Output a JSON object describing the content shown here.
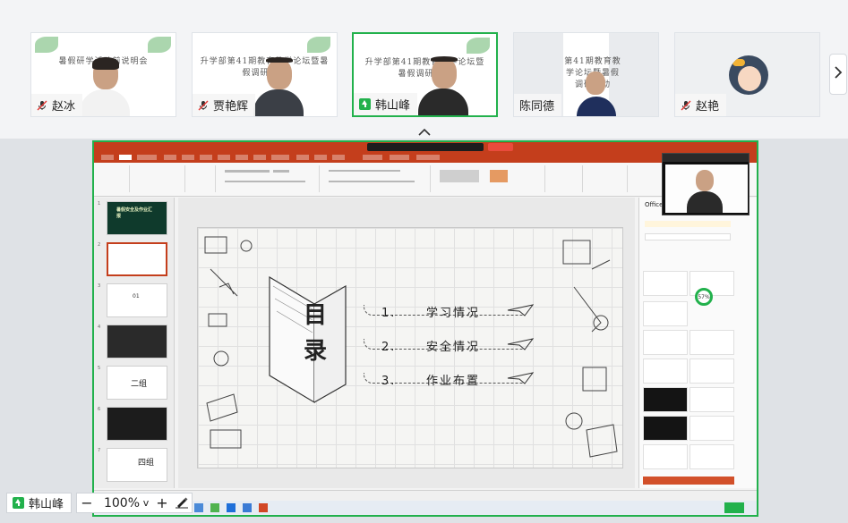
{
  "participants": [
    {
      "name": "赵冰",
      "slide_text": "暑假研学活动前说明会",
      "state": "mic-muted"
    },
    {
      "name": "贾艳辉",
      "slide_text": "升学部第41期教育教学论坛暨暑假调研活动",
      "state": "mic-muted"
    },
    {
      "name": "韩山峰",
      "slide_text": "升学部第41期教育教学论坛暨暑假调研活动",
      "state": "sharing"
    },
    {
      "name": "陈同德",
      "slide_text": "第41期教育教学论坛暨暑假调研活动",
      "state": "none"
    },
    {
      "name": "赵艳",
      "slide_text": "",
      "state": "mic-muted"
    }
  ],
  "presenter": {
    "name": "韩山峰"
  },
  "zoom": {
    "value": "100%",
    "minus": "−",
    "plus": "+",
    "dropdown": "v"
  },
  "slide": {
    "title": "目录",
    "items": [
      {
        "num": "1.",
        "label": "学习情况"
      },
      {
        "num": "2.",
        "label": "安全情况"
      },
      {
        "num": "3.",
        "label": "作业布置"
      }
    ]
  },
  "thumbnails": [
    {
      "num": "1",
      "title": "暑假安全及作业汇报"
    },
    {
      "num": "2",
      "title": ""
    },
    {
      "num": "3",
      "title": "01"
    },
    {
      "num": "4",
      "title": ""
    },
    {
      "num": "5",
      "title": "二组"
    },
    {
      "num": "6",
      "title": ""
    },
    {
      "num": "7",
      "title": "四组"
    }
  ],
  "design_panel": {
    "title": "Office",
    "percent": "57%"
  },
  "icons": {
    "muted_mic": "mic-muted-icon",
    "share": "share-screen-icon",
    "next": "chevron-right-icon",
    "collapse": "chevron-up-icon",
    "pen": "pen-icon"
  },
  "colors": {
    "accent_green": "#22b14c",
    "ppt_red": "#c43e1c"
  }
}
